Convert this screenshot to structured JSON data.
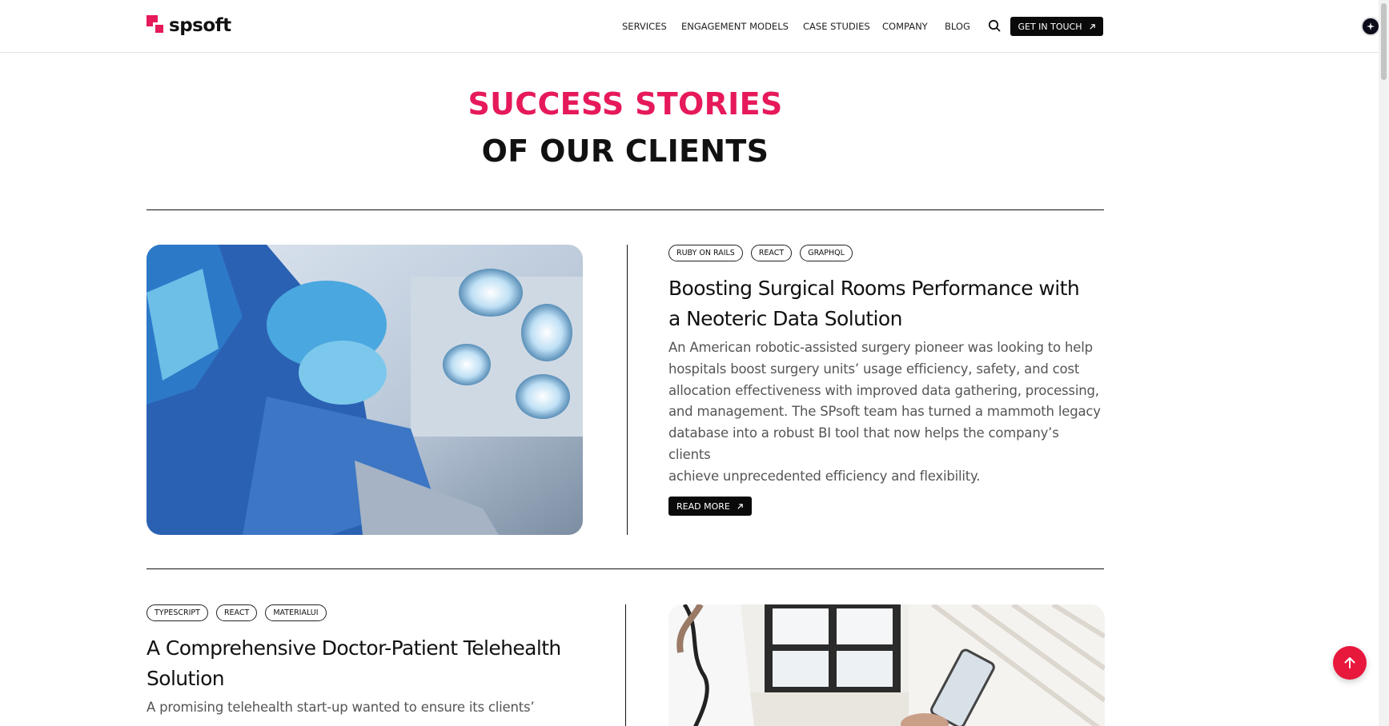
{
  "header": {
    "logo_text": "spsoft",
    "nav": [
      "SERVICES",
      "ENGAGEMENT MODELS",
      "CASE STUDIES",
      "COMPANY",
      "BLOG"
    ],
    "cta_label": "GET IN TOUCH"
  },
  "heading": {
    "line1": "SUCCESS STORIES",
    "line2": "OF OUR CLIENTS"
  },
  "cases": [
    {
      "tags": [
        "RUBY ON RAILS",
        "REACT",
        "GRAPHQL"
      ],
      "title_line1": "Boosting Surgical Rooms Performance with",
      "title_line2": "a Neoteric Data Solution",
      "desc": [
        "An American robotic-assisted surgery pioneer was looking to help",
        "hospitals boost surgery units’ usage efficiency, safety, and cost",
        "allocation effectiveness with improved data gathering, processing,",
        "and management. The SPsoft team has turned a mammoth legacy",
        "database into a robust BI tool that now helps the company’s clients",
        "achieve unprecedented efficiency and flexibility."
      ],
      "read_more": "READ MORE"
    },
    {
      "tags": [
        "TYPESCRIPT",
        "REACT",
        "MATERIALUI"
      ],
      "title_line1": "A Comprehensive Doctor-Patient Telehealth",
      "title_line2": "Solution",
      "desc": [
        "A promising telehealth start-up wanted to ensure its clients’"
      ]
    }
  ],
  "colors": {
    "accent": "#e6195a",
    "scroll_top": "#e8173c",
    "text": "#111111",
    "muted": "#555555"
  }
}
